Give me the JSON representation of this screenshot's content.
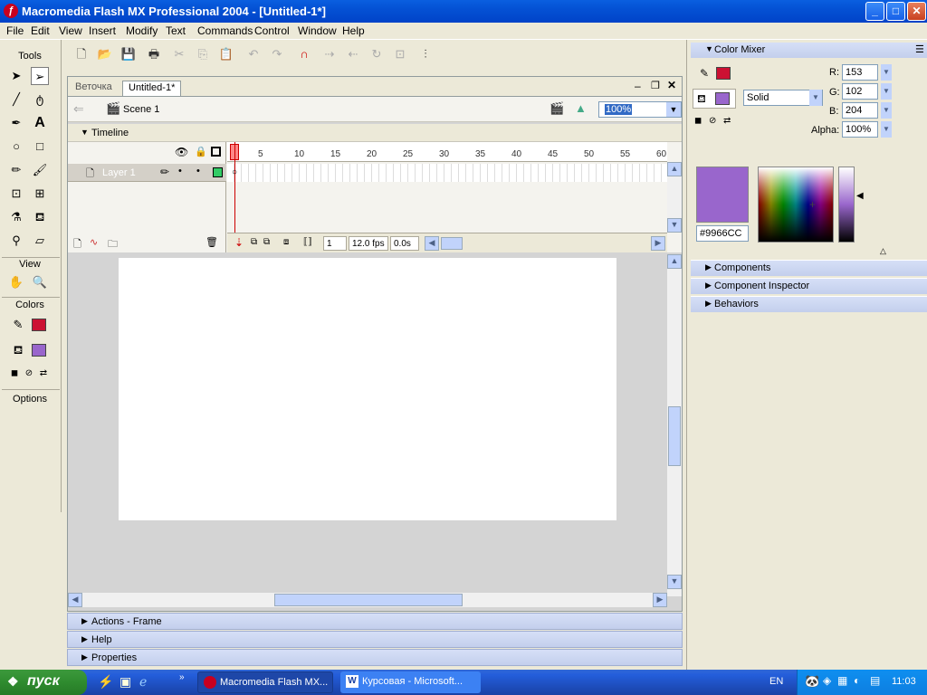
{
  "window": {
    "title": "Macromedia Flash MX Professional 2004 - [Untitled-1*]",
    "app_icon": "flash-icon"
  },
  "menu": [
    "File",
    "Edit",
    "View",
    "Insert",
    "Modify",
    "Text",
    "Commands",
    "Control",
    "Window",
    "Help"
  ],
  "tools": {
    "title": "Tools",
    "view_label": "View",
    "colors_label": "Colors",
    "options_label": "Options",
    "stroke_color": "#cc1133",
    "fill_color": "#9966cc"
  },
  "document": {
    "tabs": [
      "Веточка",
      "Untitled-1*"
    ],
    "scene": "Scene 1",
    "zoom": "100%",
    "timeline_label": "Timeline",
    "layer_name": "Layer 1",
    "ruler": [
      "1",
      "5",
      "10",
      "15",
      "20",
      "25",
      "30",
      "35",
      "40",
      "45",
      "50",
      "55",
      "60"
    ],
    "current_frame": "1",
    "fps": "12.0 fps",
    "time": "0.0s"
  },
  "bottom_panels": [
    "Actions - Frame",
    "Help",
    "Properties"
  ],
  "color_mixer": {
    "title": "Color Mixer",
    "r_label": "R:",
    "r": "153",
    "g_label": "G:",
    "g": "102",
    "b_label": "B:",
    "b": "204",
    "alpha_label": "Alpha:",
    "alpha": "100%",
    "fill_type": "Solid",
    "hex": "#9966CC",
    "stroke_color": "#cc1133",
    "fill_color": "#9966cc"
  },
  "right_panels": [
    "Components",
    "Component Inspector",
    "Behaviors"
  ],
  "taskbar": {
    "start": "пуск",
    "tasks": [
      "Macromedia Flash MX...",
      "Курсовая - Microsoft..."
    ],
    "lang": "EN",
    "clock": "11:03"
  }
}
